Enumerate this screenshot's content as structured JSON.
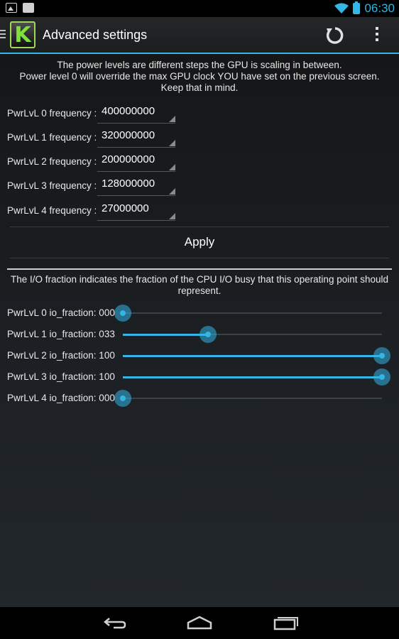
{
  "status_bar": {
    "time": "06:30",
    "icons": [
      "image-icon",
      "bag-icon",
      "wifi-icon",
      "battery-icon"
    ]
  },
  "action_bar": {
    "logo_letter": "K",
    "title": "Advanced settings",
    "actions": [
      "refresh-icon",
      "overflow-menu-icon"
    ]
  },
  "power_levels": {
    "description_line1": "The power levels are different steps the GPU is scaling in between.",
    "description_line2": "Power level 0 will override the max GPU clock YOU have set on the previous screen. Keep that in mind.",
    "rows": [
      {
        "label": "PwrLvL 0 frequency :",
        "value": "400000000"
      },
      {
        "label": "PwrLvL 1 frequency :",
        "value": "320000000"
      },
      {
        "label": "PwrLvL 2 frequency :",
        "value": "200000000"
      },
      {
        "label": "PwrLvL 3 frequency :",
        "value": "128000000"
      },
      {
        "label": "PwrLvL 4 frequency :",
        "value": "27000000"
      }
    ],
    "apply_label": "Apply"
  },
  "io_fraction": {
    "description": "The I/O fraction indicates the fraction of the CPU I/O busy that this operating point should represent.",
    "rows": [
      {
        "label": "PwrLvL 0 io_fraction: 000",
        "value": 0
      },
      {
        "label": "PwrLvL 1 io_fraction: 033",
        "value": 33
      },
      {
        "label": "PwrLvL 2 io_fraction: 100",
        "value": 100
      },
      {
        "label": "PwrLvL 3 io_fraction: 100",
        "value": 100
      },
      {
        "label": "PwrLvL 4 io_fraction: 000",
        "value": 0
      }
    ],
    "max": 100
  },
  "nav_bar": {
    "buttons": [
      "back-icon",
      "home-icon",
      "recent-apps-icon"
    ]
  },
  "colors": {
    "accent": "#33b5e5",
    "logo_green": "#7ee03b"
  }
}
